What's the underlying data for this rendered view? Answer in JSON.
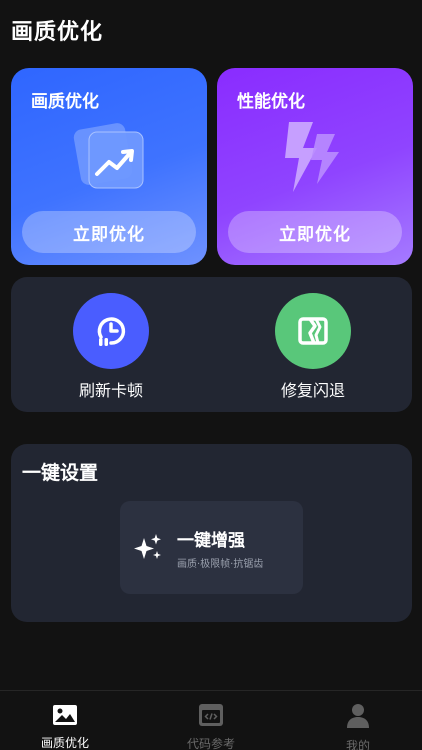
{
  "header": {
    "title": "画质优化"
  },
  "cards": [
    {
      "title": "画质优化",
      "button": "立即优化",
      "icon": "trending-chart-icon",
      "color": "#2f66ff"
    },
    {
      "title": "性能优化",
      "button": "立即优化",
      "icon": "lightning-icon",
      "color": "#8a2cff"
    }
  ],
  "tools": [
    {
      "label": "刷新卡顿",
      "icon": "refresh-clock-icon",
      "color": "#4a5dff"
    },
    {
      "label": "修复闪退",
      "icon": "repair-icon",
      "color": "#59c77a"
    }
  ],
  "settings": {
    "title": "一键设置",
    "boost": {
      "title": "一键增强",
      "subtitle": "画质·极限帧·抗锯齿",
      "icon": "sparkle-icon"
    }
  },
  "bottom_nav": [
    {
      "label": "画质优化",
      "icon": "image-icon",
      "active": true
    },
    {
      "label": "代码参考",
      "icon": "code-icon",
      "active": false
    },
    {
      "label": "我的",
      "icon": "user-icon",
      "active": false
    }
  ]
}
